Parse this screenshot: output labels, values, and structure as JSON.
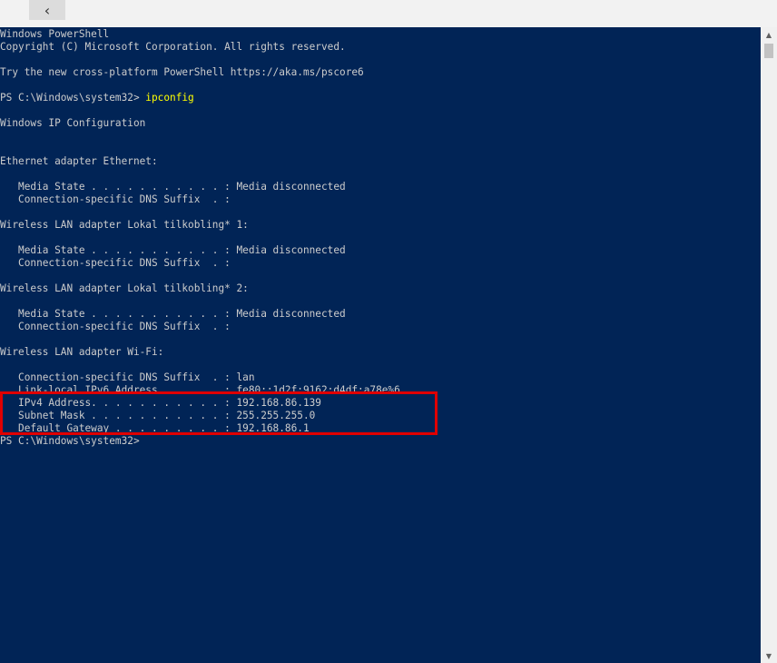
{
  "titlebar": {
    "back_icon": "‹"
  },
  "console": {
    "banner1": "Windows PowerShell",
    "banner2": "Copyright (C) Microsoft Corporation. All rights reserved.",
    "banner3": "Try the new cross-platform PowerShell https://aka.ms/pscore6",
    "prompt1": "PS C:\\Windows\\system32> ",
    "command1": "ipconfig",
    "ipconfig_header": "Windows IP Configuration",
    "eth_header": "Ethernet adapter Ethernet:",
    "eth_media": "   Media State . . . . . . . . . . . : Media disconnected",
    "eth_dns": "   Connection-specific DNS Suffix  . :",
    "wlan1_header": "Wireless LAN adapter Lokal tilkobling* 1:",
    "wlan1_media": "   Media State . . . . . . . . . . . : Media disconnected",
    "wlan1_dns": "   Connection-specific DNS Suffix  . :",
    "wlan2_header": "Wireless LAN adapter Lokal tilkobling* 2:",
    "wlan2_media": "   Media State . . . . . . . . . . . : Media disconnected",
    "wlan2_dns": "   Connection-specific DNS Suffix  . :",
    "wifi_header": "Wireless LAN adapter Wi-Fi:",
    "wifi_dns": "   Connection-specific DNS Suffix  . : lan",
    "wifi_ipv6": "   Link-local IPv6 Address . . . . . : fe80::1d2f:9162:d4df:a78e%6",
    "wifi_ipv4": "   IPv4 Address. . . . . . . . . . . : 192.168.86.139",
    "wifi_mask": "   Subnet Mask . . . . . . . . . . . : 255.255.255.0",
    "wifi_gateway": "   Default Gateway . . . . . . . . . : 192.168.86.1",
    "prompt2": "PS C:\\Windows\\system32>"
  },
  "scrollbar": {
    "up_icon": "▲",
    "down_icon": "▼"
  },
  "colors": {
    "background": "#012456",
    "text": "#cccccc",
    "command": "#ffff00",
    "highlight_border": "#e00000"
  }
}
